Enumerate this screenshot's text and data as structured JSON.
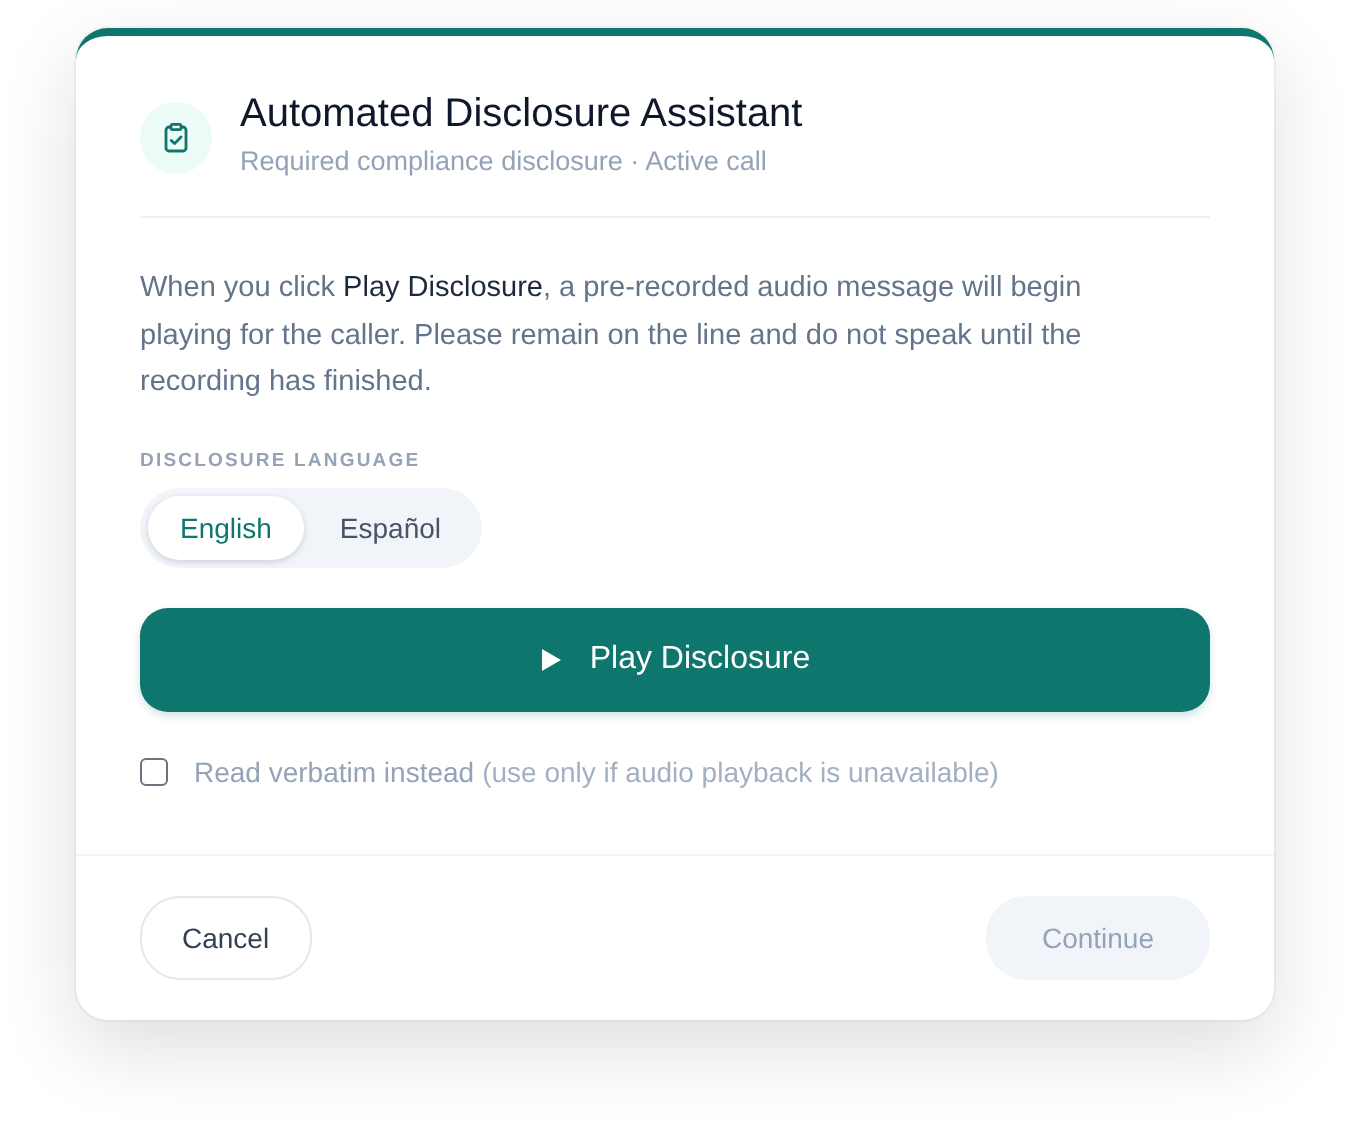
{
  "dialog": {
    "title": "Automated Disclosure Assistant",
    "subtitle": "Required compliance disclosure · Active call"
  },
  "message": "When you click **Play Disclosure**, a pre-recorded audio message will begin playing for the caller. Please remain on the line and do not speak until the recording has finished.",
  "language": {
    "label": "DISCLOSURE LANGUAGE",
    "options": [
      {
        "label": "English",
        "selected": true
      },
      {
        "label": "Español",
        "selected": false
      }
    ]
  },
  "play_button": {
    "label": "Play Disclosure"
  },
  "verbatim": {
    "label": "Read verbatim instead",
    "hint": "(use only if audio playback is unavailable)",
    "checked": false
  },
  "footer": {
    "buttons": [
      {
        "label": "Cancel",
        "kind": "secondary",
        "disabled": false
      },
      {
        "label": "Continue",
        "kind": "primary",
        "disabled": true
      }
    ]
  }
}
